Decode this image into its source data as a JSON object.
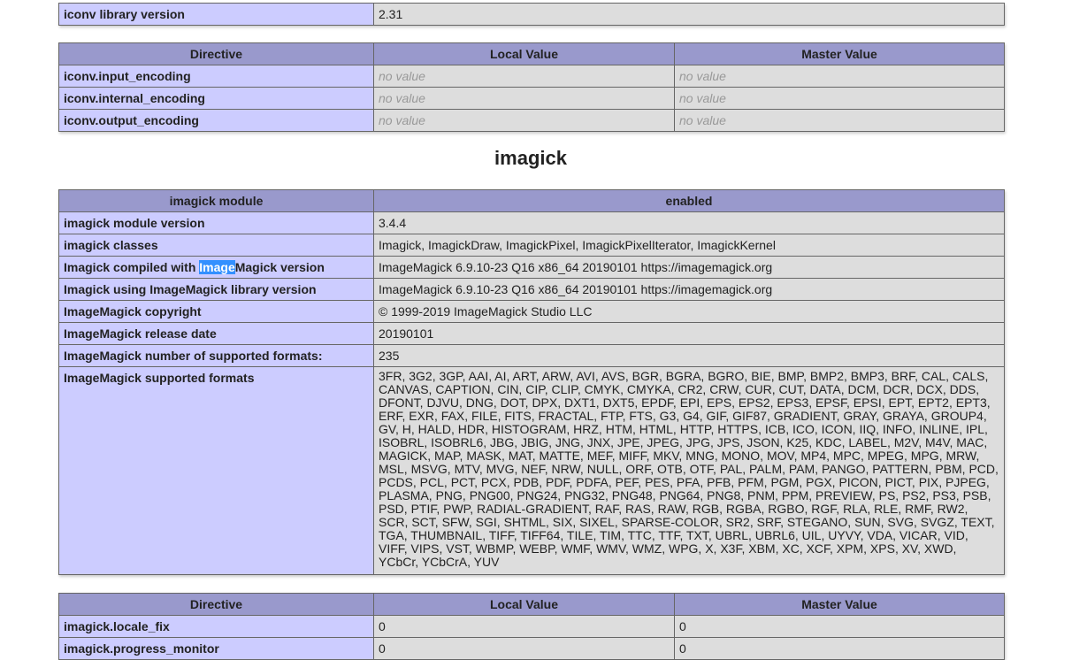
{
  "iconv_info": {
    "label": "iconv library version",
    "value": "2.31"
  },
  "directive_headers": [
    "Directive",
    "Local Value",
    "Master Value"
  ],
  "iconv_directives": [
    {
      "name": "iconv.input_encoding",
      "local": "no value",
      "master": "no value"
    },
    {
      "name": "iconv.internal_encoding",
      "local": "no value",
      "master": "no value"
    },
    {
      "name": "iconv.output_encoding",
      "local": "no value",
      "master": "no value"
    }
  ],
  "section_title": "imagick",
  "imagick_header": {
    "label": "imagick module",
    "value": "enabled"
  },
  "imagick_rows": [
    {
      "label": "imagick module version",
      "value": "3.4.4"
    },
    {
      "label": "imagick classes",
      "value": "Imagick, ImagickDraw, ImagickPixel, ImagickPixelIterator, ImagickKernel"
    },
    {
      "label_prefix": "Imagick compiled with ",
      "label_selected": "Image",
      "label_suffix": "Magick version",
      "value": "ImageMagick 6.9.10-23 Q16 x86_64 20190101 https://imagemagick.org"
    },
    {
      "label": "Imagick using ImageMagick library version",
      "value": "ImageMagick 6.9.10-23 Q16 x86_64 20190101 https://imagemagick.org"
    },
    {
      "label": "ImageMagick copyright",
      "value": "© 1999-2019 ImageMagick Studio LLC"
    },
    {
      "label": "ImageMagick release date",
      "value": "20190101"
    },
    {
      "label": "ImageMagick number of supported formats:",
      "value": "235"
    },
    {
      "label": "ImageMagick supported formats",
      "value": "3FR, 3G2, 3GP, AAI, AI, ART, ARW, AVI, AVS, BGR, BGRA, BGRO, BIE, BMP, BMP2, BMP3, BRF, CAL, CALS, CANVAS, CAPTION, CIN, CIP, CLIP, CMYK, CMYKA, CR2, CRW, CUR, CUT, DATA, DCM, DCR, DCX, DDS, DFONT, DJVU, DNG, DOT, DPX, DXT1, DXT5, EPDF, EPI, EPS, EPS2, EPS3, EPSF, EPSI, EPT, EPT2, EPT3, ERF, EXR, FAX, FILE, FITS, FRACTAL, FTP, FTS, G3, G4, GIF, GIF87, GRADIENT, GRAY, GRAYA, GROUP4, GV, H, HALD, HDR, HISTOGRAM, HRZ, HTM, HTML, HTTP, HTTPS, ICB, ICO, ICON, IIQ, INFO, INLINE, IPL, ISOBRL, ISOBRL6, JBG, JBIG, JNG, JNX, JPE, JPEG, JPG, JPS, JSON, K25, KDC, LABEL, M2V, M4V, MAC, MAGICK, MAP, MASK, MAT, MATTE, MEF, MIFF, MKV, MNG, MONO, MOV, MP4, MPC, MPEG, MPG, MRW, MSL, MSVG, MTV, MVG, NEF, NRW, NULL, ORF, OTB, OTF, PAL, PALM, PAM, PANGO, PATTERN, PBM, PCD, PCDS, PCL, PCT, PCX, PDB, PDF, PDFA, PEF, PES, PFA, PFB, PFM, PGM, PGX, PICON, PICT, PIX, PJPEG, PLASMA, PNG, PNG00, PNG24, PNG32, PNG48, PNG64, PNG8, PNM, PPM, PREVIEW, PS, PS2, PS3, PSB, PSD, PTIF, PWP, RADIAL-GRADIENT, RAF, RAS, RAW, RGB, RGBA, RGBO, RGF, RLA, RLE, RMF, RW2, SCR, SCT, SFW, SGI, SHTML, SIX, SIXEL, SPARSE-COLOR, SR2, SRF, STEGANO, SUN, SVG, SVGZ, TEXT, TGA, THUMBNAIL, TIFF, TIFF64, TILE, TIM, TTC, TTF, TXT, UBRL, UBRL6, UIL, UYVY, VDA, VICAR, VID, VIFF, VIPS, VST, WBMP, WEBP, WMF, WMV, WMZ, WPG, X, X3F, XBM, XC, XCF, XPM, XPS, XV, XWD, YCbCr, YCbCrA, YUV"
    }
  ],
  "imagick_directives": [
    {
      "name": "imagick.locale_fix",
      "local": "0",
      "master": "0"
    },
    {
      "name": "imagick.progress_monitor",
      "local": "0",
      "master": "0"
    }
  ]
}
